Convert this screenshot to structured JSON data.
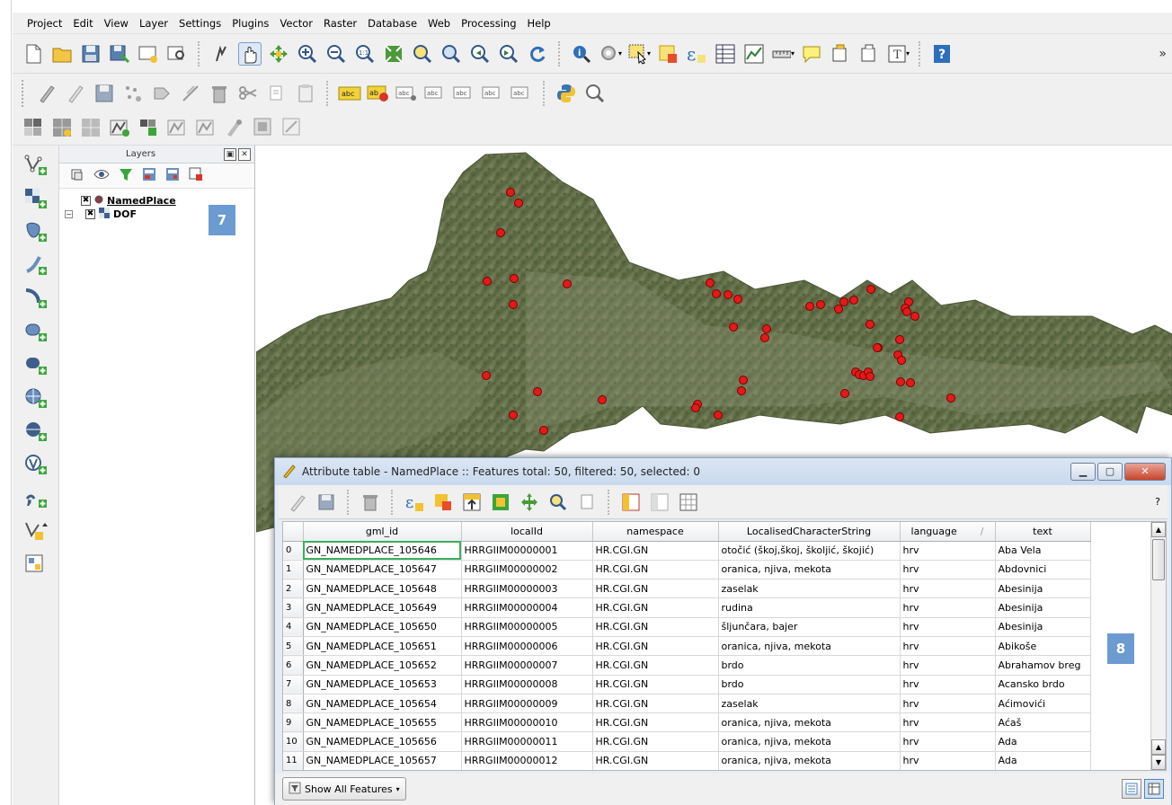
{
  "menubar": [
    "Project",
    "Edit",
    "View",
    "Layer",
    "Settings",
    "Plugins",
    "Vector",
    "Raster",
    "Database",
    "Web",
    "Processing",
    "Help"
  ],
  "layers_panel": {
    "title": "Layers",
    "items": [
      {
        "name": "NamedPlace",
        "checked_mark": "✖"
      },
      {
        "name": "DOF",
        "checked_mark": "✖"
      }
    ],
    "badge": "7"
  },
  "toolbar": {
    "overflow": "»"
  },
  "attribute_table": {
    "title": "Attribute table - NamedPlace :: Features total: 50, filtered: 50, selected: 0",
    "help": "?",
    "columns": [
      "gml_id",
      "localId",
      "namespace",
      "LocalisedCharacterString",
      "language",
      "text"
    ],
    "rows": [
      [
        "0",
        "GN_NAMEDPLACE_105646",
        "HRRGIIM00000001",
        "HR.CGI.GN",
        "otočić (škoj,škoj, školjić, škojić)",
        "hrv",
        "Aba Vela"
      ],
      [
        "1",
        "GN_NAMEDPLACE_105647",
        "HRRGIIM00000002",
        "HR.CGI.GN",
        "oranica, njiva, mekota",
        "hrv",
        "Abdovnici"
      ],
      [
        "2",
        "GN_NAMEDPLACE_105648",
        "HRRGIIM00000003",
        "HR.CGI.GN",
        "zaselak",
        "hrv",
        "Abesinija"
      ],
      [
        "3",
        "GN_NAMEDPLACE_105649",
        "HRRGIIM00000004",
        "HR.CGI.GN",
        "rudina",
        "hrv",
        "Abesinija"
      ],
      [
        "4",
        "GN_NAMEDPLACE_105650",
        "HRRGIIM00000005",
        "HR.CGI.GN",
        "šljunčara, bajer",
        "hrv",
        "Abesinija"
      ],
      [
        "5",
        "GN_NAMEDPLACE_105651",
        "HRRGIIM00000006",
        "HR.CGI.GN",
        "oranica, njiva, mekota",
        "hrv",
        "Abikoše"
      ],
      [
        "6",
        "GN_NAMEDPLACE_105652",
        "HRRGIIM00000007",
        "HR.CGI.GN",
        "brdo",
        "hrv",
        "Abrahamov breg"
      ],
      [
        "7",
        "GN_NAMEDPLACE_105653",
        "HRRGIIM00000008",
        "HR.CGI.GN",
        "brdo",
        "hrv",
        "Acansko brdo"
      ],
      [
        "8",
        "GN_NAMEDPLACE_105654",
        "HRRGIIM00000009",
        "HR.CGI.GN",
        "zaselak",
        "hrv",
        "Aćimovići"
      ],
      [
        "9",
        "GN_NAMEDPLACE_105655",
        "HRRGIIM00000010",
        "HR.CGI.GN",
        "oranica, njiva, mekota",
        "hrv",
        "Aćaš"
      ],
      [
        "10",
        "GN_NAMEDPLACE_105656",
        "HRRGIIM00000011",
        "HR.CGI.GN",
        "oranica, njiva, mekota",
        "hrv",
        "Ada"
      ],
      [
        "11",
        "GN_NAMEDPLACE_105657",
        "HRRGIIM00000012",
        "HR.CGI.GN",
        "oranica, njiva, mekota",
        "hrv",
        "Ada"
      ]
    ],
    "badge": "8",
    "show_all_label": "Show All Features",
    "sort_indicator": "/"
  },
  "colors": {
    "point": "#e21a1a",
    "badge": "#6c9bd2",
    "selection_outline": "#3cae5c"
  }
}
